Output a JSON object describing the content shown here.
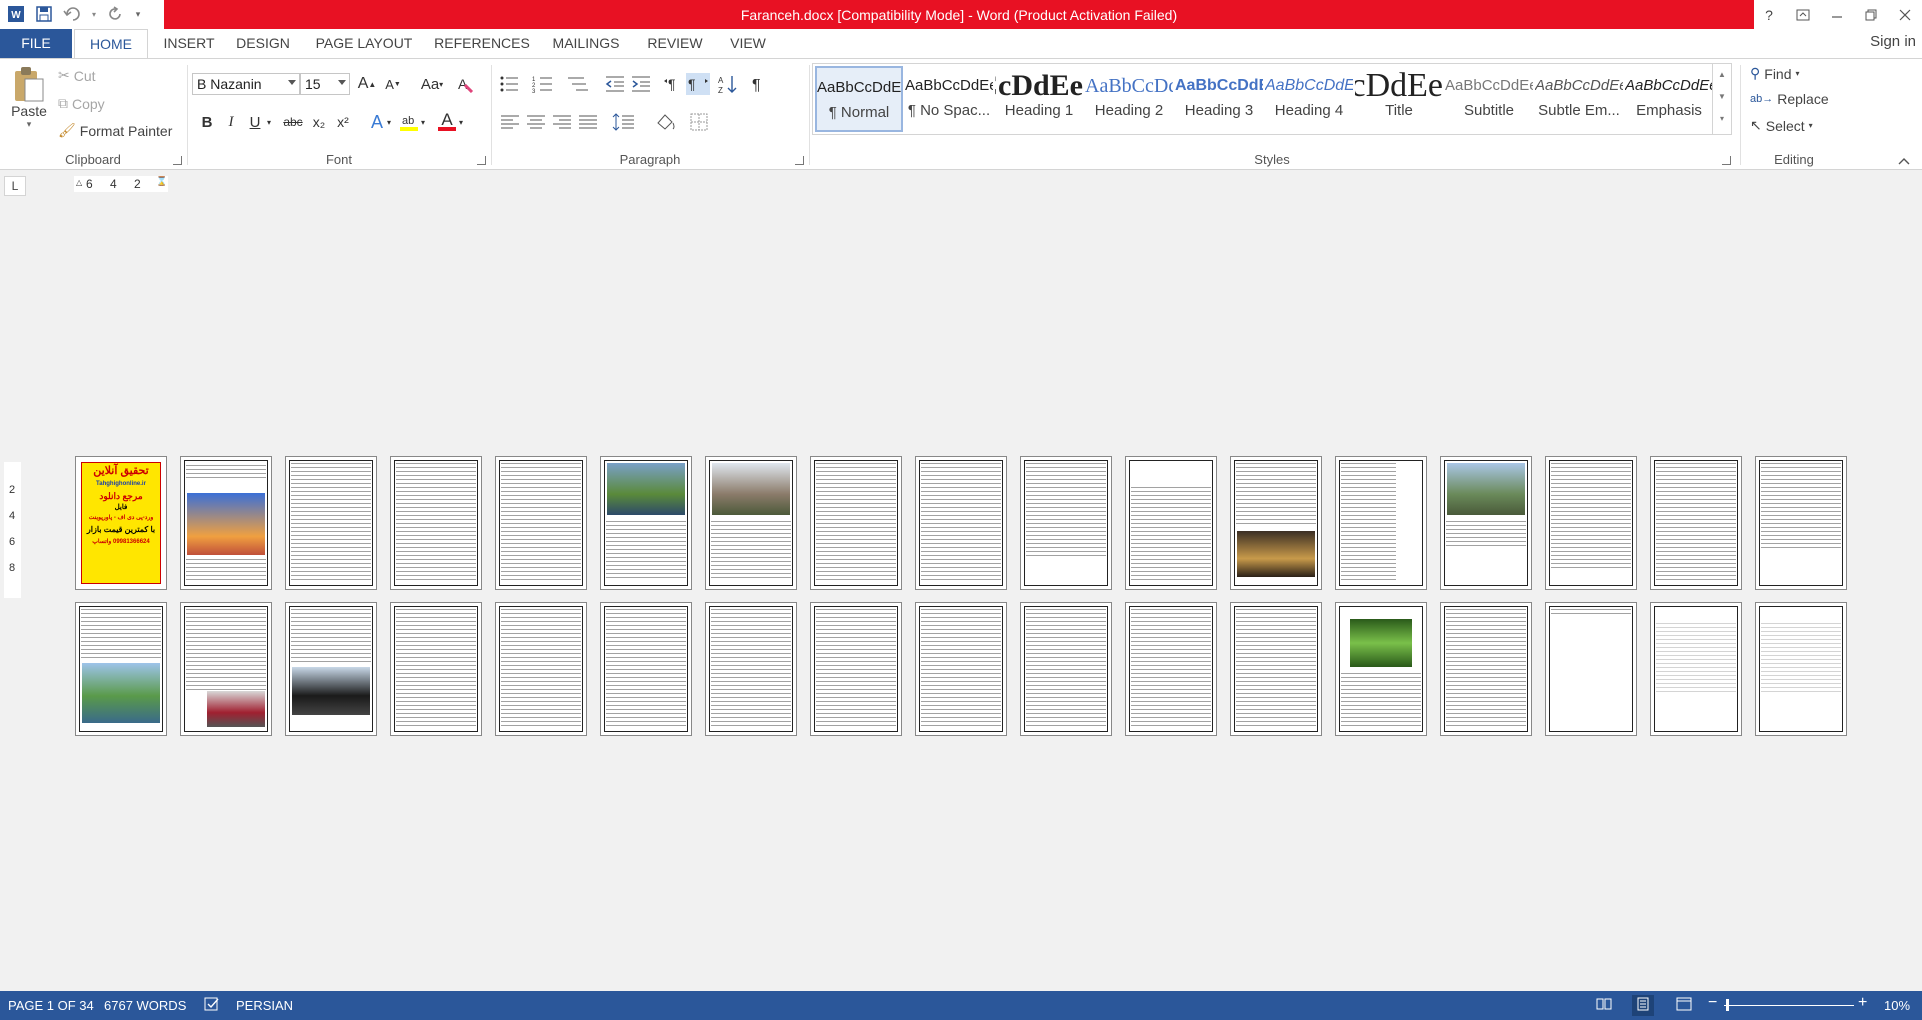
{
  "window": {
    "title": "Faranceh.docx [Compatibility Mode] -  Word (Product Activation Failed)"
  },
  "title_bar_controls": {
    "help": "?"
  },
  "tabs": {
    "file": "FILE",
    "home": "HOME",
    "insert": "INSERT",
    "design": "DESIGN",
    "page_layout": "PAGE LAYOUT",
    "references": "REFERENCES",
    "mailings": "MAILINGS",
    "review": "REVIEW",
    "view": "VIEW",
    "sign_in": "Sign in"
  },
  "clipboard": {
    "paste": "Paste",
    "cut": "Cut",
    "copy": "Copy",
    "format_painter": "Format Painter",
    "label": "Clipboard"
  },
  "font": {
    "name": "B Nazanin",
    "size": "15",
    "bold": "B",
    "italic": "I",
    "underline": "U",
    "strike": "abc",
    "subscript": "x₂",
    "superscript": "x²",
    "change_case": "Aa",
    "grow": "A",
    "shrink": "A",
    "text_effects": "A",
    "font_color": "A",
    "label": "Font"
  },
  "paragraph": {
    "label": "Paragraph"
  },
  "styles": {
    "label": "Styles",
    "items": [
      {
        "sample": "AaBbCcDdEe",
        "name": "¶ Normal"
      },
      {
        "sample": "AaBbCcDdEe",
        "name": "¶ No Spac..."
      },
      {
        "sample": "AaBbCcDdEe",
        "name": "Heading 1"
      },
      {
        "sample": "AaBbCcDdEe",
        "name": "Heading 2"
      },
      {
        "sample": "AaBbCcDdEe",
        "name": "Heading 3"
      },
      {
        "sample": "AaBbCcDdEe",
        "name": "Heading 4"
      },
      {
        "sample": "AaBbCcDdEe",
        "name": "Title"
      },
      {
        "sample": "AaBbCcDdEe",
        "name": "Subtitle"
      },
      {
        "sample": "AaBbCcDdEe",
        "name": "Subtle Em..."
      },
      {
        "sample": "AaBbCcDdEe",
        "name": "Emphasis"
      }
    ]
  },
  "editing": {
    "find": "Find",
    "replace": "Replace",
    "select": "Select",
    "label": "Editing"
  },
  "ruler": {
    "corner": "L",
    "h_ticks": [
      "6",
      "4",
      "2"
    ],
    "v_ticks": [
      "2",
      "4",
      "6",
      "8"
    ]
  },
  "document": {
    "cover_text": [
      "تحقیق آنلاین",
      "Tahghighonline.ir",
      "مرجع دانلود",
      "فایل",
      "ورد-پی دی اف - پاورپوینت",
      "با کمترین قیمت بازار",
      "09981366624 واتساپ"
    ]
  },
  "status": {
    "page": "PAGE 1 OF 34",
    "words": "6767 WORDS",
    "language": "PERSIAN",
    "zoom": "10%"
  },
  "colors": {
    "brand": "#2b579a",
    "title_alert": "#e81123"
  }
}
